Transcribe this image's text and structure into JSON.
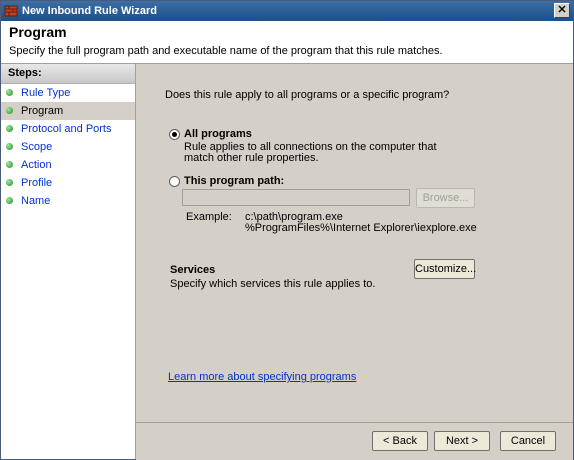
{
  "window": {
    "title": "New Inbound Rule Wizard"
  },
  "header": {
    "title": "Program",
    "description": "Specify the full program path and executable name of the program that this rule matches."
  },
  "steps": {
    "heading": "Steps:",
    "items": [
      {
        "label": "Rule Type",
        "active": false
      },
      {
        "label": "Program",
        "active": true
      },
      {
        "label": "Protocol and Ports",
        "active": false
      },
      {
        "label": "Scope",
        "active": false
      },
      {
        "label": "Action",
        "active": false
      },
      {
        "label": "Profile",
        "active": false
      },
      {
        "label": "Name",
        "active": false
      }
    ]
  },
  "content": {
    "question": "Does this rule apply to all programs or a specific program?",
    "all_programs": {
      "label": "All programs",
      "description": "Rule applies to all connections on the computer that match other rule properties.",
      "selected": true
    },
    "program_path": {
      "label": "This program path:",
      "value": "",
      "selected": false,
      "browse_label": "Browse..."
    },
    "example": {
      "label": "Example:",
      "line1": "c:\\path\\program.exe",
      "line2": "%ProgramFiles%\\Internet Explorer\\iexplore.exe"
    },
    "services": {
      "heading": "Services",
      "description": "Specify which services this rule applies to.",
      "customize_label": "Customize..."
    },
    "learn_more": "Learn more about specifying programs"
  },
  "footer": {
    "back_label": "< Back",
    "next_label": "Next >",
    "cancel_label": "Cancel"
  }
}
